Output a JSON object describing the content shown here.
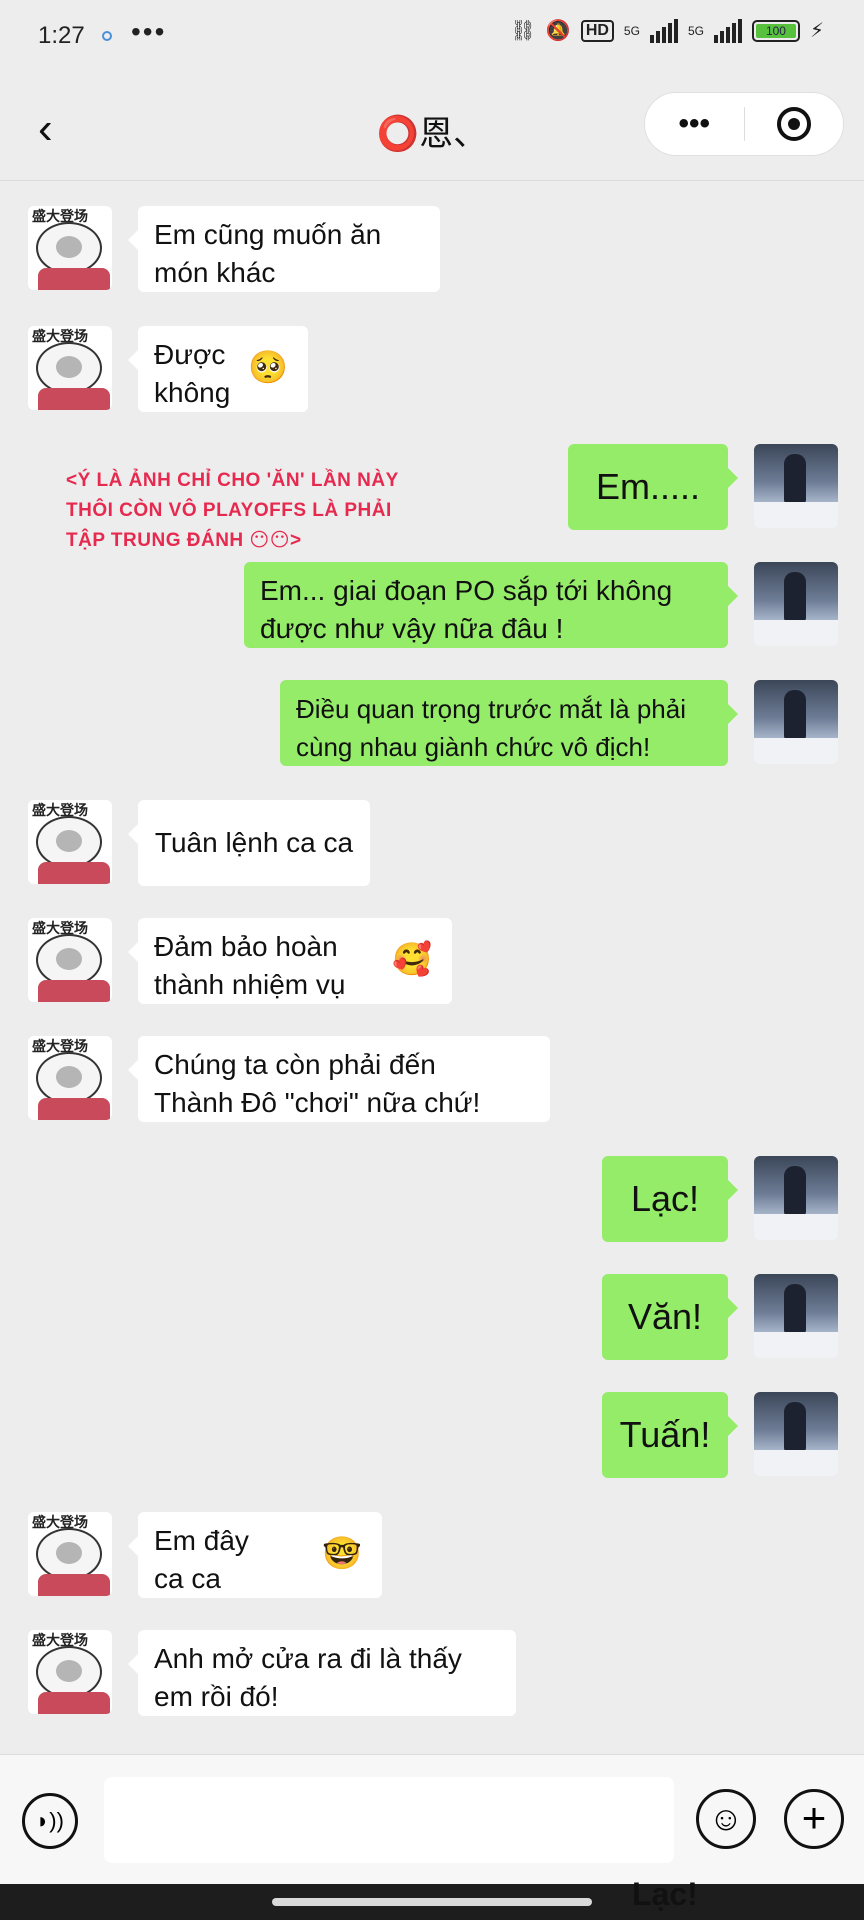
{
  "status": {
    "time": "1:27",
    "more": "•••",
    "network": "HD",
    "sig1": "5G",
    "sig2": "5G",
    "battery": "100"
  },
  "header": {
    "back": "‹",
    "title": "⭕恩、",
    "more": "•••"
  },
  "note": {
    "line1": "<Ý LÀ ẢNH CHỈ CHO 'ĂN' LẦN NÀY",
    "line2": "THÔI CÒN VÔ PLAYOFFS LÀ PHẢI",
    "line3": "TẬP TRUNG ĐÁNH 😶😶>"
  },
  "avatar_tag": "盛大登场",
  "messages": [
    {
      "side": "left",
      "line1": "Em cũng muốn ăn",
      "line2": "món khác",
      "emoji": ""
    },
    {
      "side": "left",
      "line1": "Được",
      "line2": "không",
      "emoji": "🥺"
    },
    {
      "side": "right",
      "line1": "Em.....",
      "line2": "",
      "emoji": ""
    },
    {
      "side": "right",
      "line1": "Em... giai đoạn PO sắp tới không",
      "line2": "được như vậy nữa đâu !",
      "emoji": ""
    },
    {
      "side": "right",
      "line1": "Điều quan trọng trước mắt là phải",
      "line2": "cùng nhau giành chức vô địch!",
      "emoji": ""
    },
    {
      "side": "left",
      "line1": "Tuân lệnh ca ca",
      "line2": "",
      "emoji": ""
    },
    {
      "side": "left",
      "line1": "Đảm bảo hoàn",
      "line2": "thành nhiệm vụ",
      "emoji": "🥰"
    },
    {
      "side": "left",
      "line1": "Chúng ta còn phải đến",
      "line2": "Thành Đô \"chơi\" nữa chứ!",
      "emoji": ""
    },
    {
      "side": "right",
      "line1": "Lạc!",
      "line2": "",
      "emoji": ""
    },
    {
      "side": "right",
      "line1": "Văn!",
      "line2": "",
      "emoji": ""
    },
    {
      "side": "right",
      "line1": "Tuấn!",
      "line2": "",
      "emoji": ""
    },
    {
      "side": "left",
      "line1": "Em đây",
      "line2": "ca ca",
      "emoji": "🤓"
    },
    {
      "side": "left",
      "line1": "Anh mở cửa ra đi là thấy",
      "line2": "em rồi đó!",
      "emoji": ""
    }
  ],
  "input": {
    "placeholder": "",
    "voice": "◗))",
    "smile": "☺",
    "plus": "+"
  },
  "stray_text": "Lạc!"
}
